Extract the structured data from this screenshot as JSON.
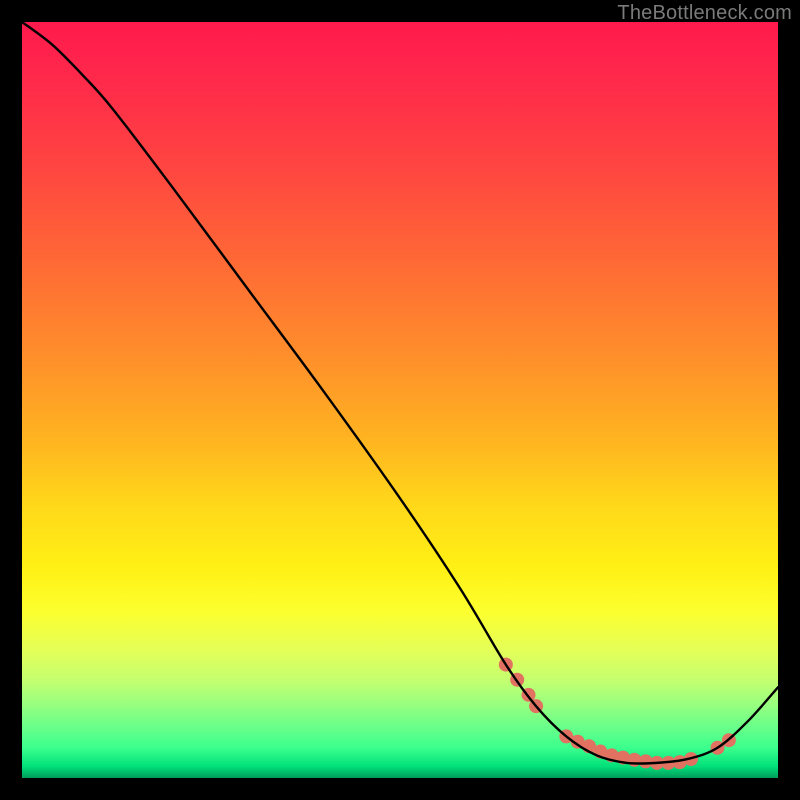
{
  "watermark": "TheBottleneck.com",
  "chart_data": {
    "type": "line",
    "title": "",
    "xlabel": "",
    "ylabel": "",
    "xlim": [
      0,
      100
    ],
    "ylim": [
      0,
      100
    ],
    "grid": false,
    "legend": false,
    "series": [
      {
        "name": "curve",
        "color": "#000000",
        "x": [
          0,
          4,
          8,
          12,
          20,
          30,
          40,
          50,
          58,
          64,
          68,
          72,
          76,
          80,
          84,
          88,
          92,
          96,
          100
        ],
        "y": [
          100,
          97,
          93,
          88.5,
          78,
          64.5,
          51,
          37,
          25,
          15,
          9.5,
          5.5,
          3,
          2,
          2,
          2.5,
          4,
          7.5,
          12
        ]
      }
    ],
    "markers": {
      "name": "highlight-dots",
      "color": "#e17161",
      "radius_px": 7,
      "x": [
        64,
        65.5,
        67,
        68,
        72,
        73.5,
        75,
        76.5,
        78,
        79.5,
        81,
        82.5,
        84,
        85.5,
        87,
        88.5,
        92,
        93.5
      ],
      "y": [
        15,
        13,
        11,
        9.5,
        5.5,
        4.8,
        4.2,
        3.5,
        3,
        2.7,
        2.4,
        2.2,
        2,
        2,
        2.1,
        2.5,
        4,
        5
      ]
    },
    "background_gradient": {
      "direction": "vertical",
      "stops": [
        {
          "pos": 0.0,
          "color": "#ff1a4d"
        },
        {
          "pos": 0.2,
          "color": "#ff4740"
        },
        {
          "pos": 0.44,
          "color": "#ff8e2b"
        },
        {
          "pos": 0.64,
          "color": "#ffd81a"
        },
        {
          "pos": 0.78,
          "color": "#fcff2e"
        },
        {
          "pos": 0.9,
          "color": "#9cff7e"
        },
        {
          "pos": 0.98,
          "color": "#00e07a"
        },
        {
          "pos": 1.0,
          "color": "#009a5a"
        }
      ]
    }
  }
}
